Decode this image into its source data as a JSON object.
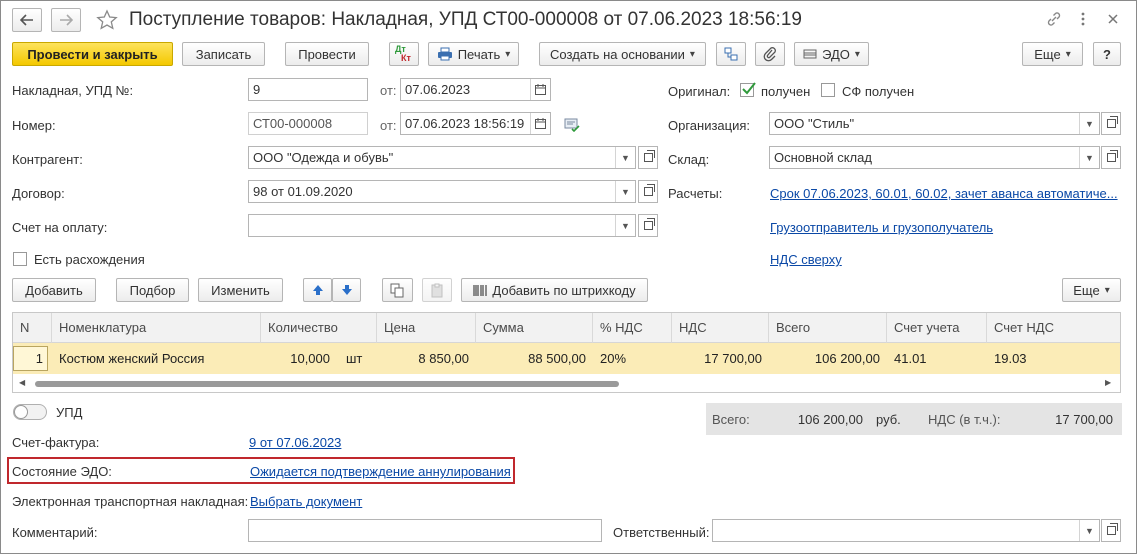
{
  "window": {
    "title": "Поступление товаров: Накладная, УПД СТ00-000008 от 07.06.2023 18:56:19"
  },
  "toolbar": {
    "post_close": "Провести и закрыть",
    "save": "Записать",
    "post": "Провести",
    "dtkt_top": "Дт",
    "dtkt_bottom": "Кт",
    "print": "Печать",
    "create_based": "Создать на основании",
    "edo": "ЭДО",
    "more": "Еще",
    "help": "?"
  },
  "form": {
    "invoice_label": "Накладная, УПД №:",
    "invoice_value": "9",
    "from_label": "от:",
    "invoice_date": "07.06.2023",
    "number_label": "Номер:",
    "number_value": "СТ00-000008",
    "number_date": "07.06.2023 18:56:19",
    "counterparty_label": "Контрагент:",
    "counterparty_value": "ООО \"Одежда и обувь\"",
    "contract_label": "Договор:",
    "contract_value": "98 от 01.09.2020",
    "payment_invoice_label": "Счет на оплату:",
    "payment_invoice_value": "",
    "discrepancies_label": "Есть расхождения",
    "original_label": "Оригинал:",
    "received_label": "получен",
    "sf_received_label": "СФ получен",
    "organization_label": "Организация:",
    "organization_value": "ООО \"Стиль\"",
    "warehouse_label": "Склад:",
    "warehouse_value": "Основной склад",
    "settlements_label": "Расчеты:",
    "settlements_link": "Срок 07.06.2023, 60.01, 60.02, зачет аванса автоматиче...",
    "shipper_link": "Грузоотправитель и грузополучатель",
    "vat_link": "НДС сверху"
  },
  "table_toolbar": {
    "add": "Добавить",
    "pick": "Подбор",
    "edit": "Изменить",
    "barcode": "Добавить по штрихкоду",
    "more": "Еще"
  },
  "table": {
    "headers": [
      "N",
      "Номенклатура",
      "Количество",
      "Цена",
      "Сумма",
      "% НДС",
      "НДС",
      "Всего",
      "Счет учета",
      "Счет НДС"
    ],
    "rows": [
      {
        "n": "1",
        "item": "Костюм женский Россия",
        "qty": "10,000",
        "unit": "шт",
        "price": "8 850,00",
        "sum": "88 500,00",
        "vat_rate": "20%",
        "vat": "17 700,00",
        "total": "106 200,00",
        "account": "41.01",
        "vat_account": "19.03"
      }
    ]
  },
  "footer": {
    "upd_label": "УПД",
    "upd_toggle": "off",
    "invoice_sf_label": "Счет-фактура:",
    "invoice_sf_link": "9 от 07.06.2023",
    "edo_state_label": "Состояние ЭДО:",
    "edo_state_link": "Ожидается подтверждение аннулирования",
    "etn_label": "Электронная транспортная накладная:",
    "etn_link": "Выбрать документ",
    "comment_label": "Комментарий:",
    "comment_value": "",
    "responsible_label": "Ответственный:",
    "responsible_value": "",
    "total_label": "Всего:",
    "total_value": "106 200,00",
    "currency": "руб.",
    "vat_incl_label": "НДС (в т.ч.):",
    "vat_incl_value": "17 700,00"
  },
  "colors": {
    "primary_button": "#f4c800",
    "link": "#0a48a6",
    "selected_row": "#fbecb7",
    "highlight_border": "#c0282d",
    "check": "#2f9a3b"
  }
}
